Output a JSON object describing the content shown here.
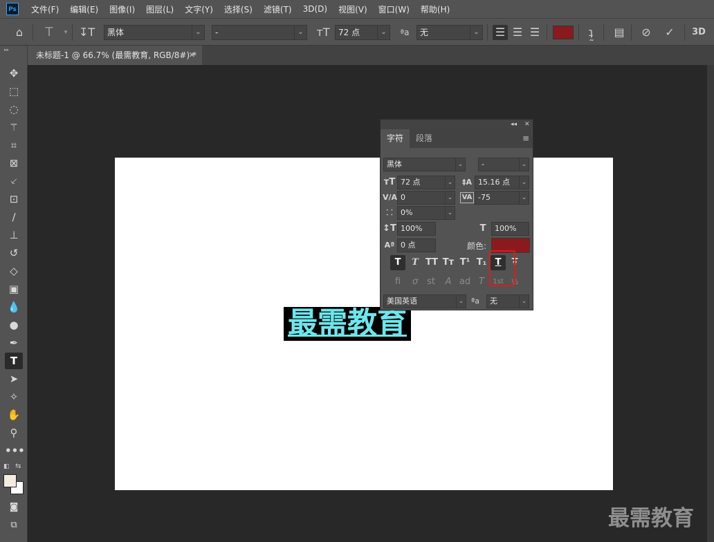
{
  "app": {
    "logo": "Ps"
  },
  "menu": [
    "文件(F)",
    "编辑(E)",
    "图像(I)",
    "图层(L)",
    "文字(Y)",
    "选择(S)",
    "滤镜(T)",
    "3D(D)",
    "视图(V)",
    "窗口(W)",
    "帮助(H)"
  ],
  "options": {
    "font_family": "黑体",
    "font_style": "-",
    "font_size": "72 点",
    "antialias_label": "ªa",
    "antialias": "无",
    "text_color": "#8b1a1e",
    "threed_label": "3D"
  },
  "document": {
    "tab_title": "未标题-1 @ 66.7% (最需教育, RGB/8#) *",
    "canvas_text": "最需教育",
    "canvas_text_color": "#6ee6ec"
  },
  "character_panel": {
    "tabs": [
      "字符",
      "段落"
    ],
    "font_family": "黑体",
    "font_style": "-",
    "font_size": "72 点",
    "leading": "15.16 点",
    "kerning": "0",
    "tracking": "-75",
    "tsume": "0%",
    "vertical_scale": "100%",
    "horizontal_scale": "100%",
    "baseline_shift": "0 点",
    "color_label": "颜色:",
    "color": "#8b1a1e",
    "language": "美国英语",
    "antialias_label": "ªa",
    "antialias": "无",
    "style_buttons": [
      "T",
      "T",
      "TT",
      "Tт",
      "T¹",
      "T₁",
      "T",
      "Ŧ"
    ],
    "opentype_buttons": [
      "fi",
      "ơ",
      "st",
      "A",
      "ad",
      "T",
      "1st",
      "½"
    ]
  },
  "watermark": "最需教育"
}
